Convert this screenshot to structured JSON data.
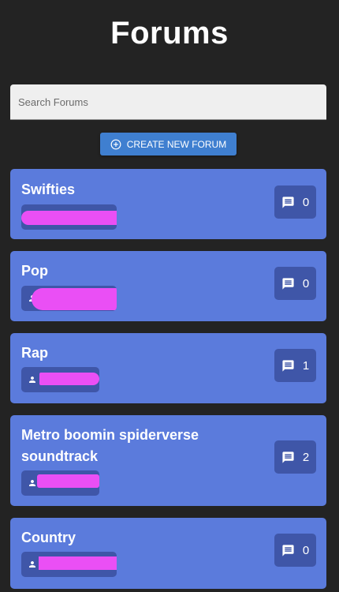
{
  "page": {
    "title": "Forums"
  },
  "search": {
    "placeholder": "Search Forums"
  },
  "create_button": {
    "label": "CREATE NEW FORUM",
    "icon": "plus-circle-icon"
  },
  "forums": [
    {
      "name": "Swifties",
      "comment_count": "0",
      "author_redacted": true
    },
    {
      "name": "Pop",
      "comment_count": "0",
      "author_redacted": true
    },
    {
      "name": "Rap",
      "comment_count": "1",
      "author_redacted": true
    },
    {
      "name": "Metro boomin spiderverse soundtrack",
      "comment_count": "2",
      "author_redacted": true
    },
    {
      "name": "Country",
      "comment_count": "0",
      "author_redacted": true
    }
  ],
  "colors": {
    "background": "#232323",
    "card": "#5b7bdc",
    "chip": "#3f56a8",
    "button": "#3f7fd0",
    "redaction": "#ea4ff5"
  }
}
